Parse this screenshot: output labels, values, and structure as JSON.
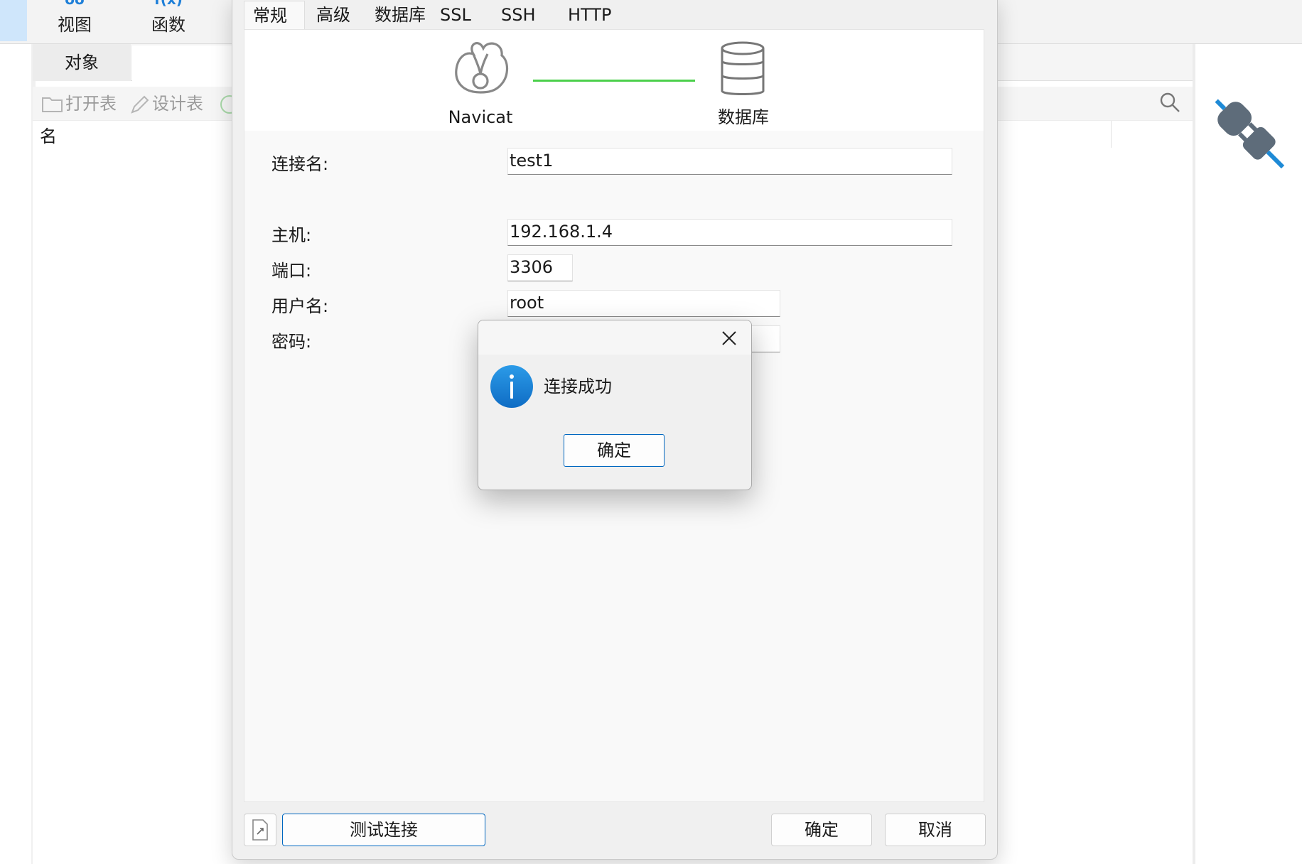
{
  "main_window": {
    "toolbar": [
      {
        "label": "视图"
      },
      {
        "label": "函数"
      }
    ],
    "tab_label": "对象",
    "actions": {
      "open_table": "打开表",
      "design_table": "设计表"
    },
    "column_header": "名"
  },
  "dialog": {
    "tabs": [
      "常规",
      "高级",
      "数据库",
      "SSL",
      "SSH",
      "HTTP"
    ],
    "active_tab": "常规",
    "diagram": {
      "left_label": "Navicat",
      "right_label": "数据库"
    },
    "fields": {
      "connection_name": {
        "label": "连接名:",
        "value": "test1"
      },
      "host": {
        "label": "主机:",
        "value": "192.168.1.4"
      },
      "port": {
        "label": "端口:",
        "value": "3306"
      },
      "username": {
        "label": "用户名:",
        "value": "root"
      },
      "password": {
        "label": "密码:",
        "value": ""
      }
    },
    "buttons": {
      "test_connection": "测试连接",
      "ok": "确定",
      "cancel": "取消"
    }
  },
  "message_box": {
    "text": "连接成功",
    "ok_label": "确定",
    "icon": "info-icon"
  },
  "colors": {
    "accent": "#0067c0",
    "connection_line": "#4bd04b",
    "info_blue": "#1e8ad6"
  }
}
